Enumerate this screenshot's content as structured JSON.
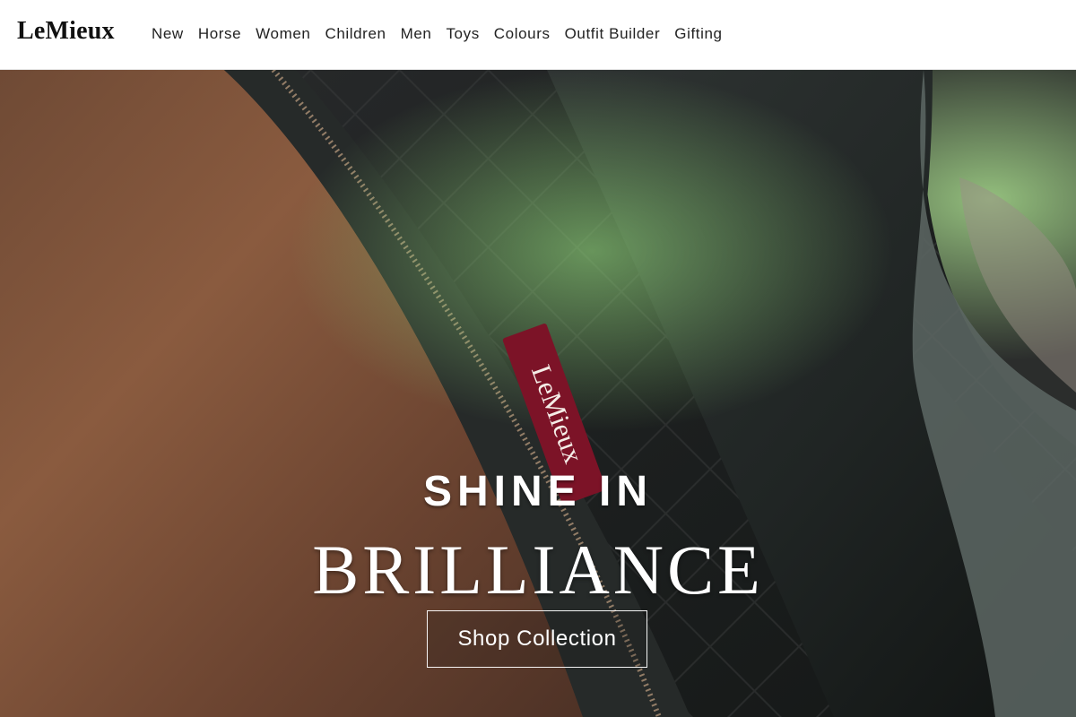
{
  "header": {
    "brand": "LeMieux",
    "nav_items": [
      {
        "label": "New"
      },
      {
        "label": "Horse"
      },
      {
        "label": "Women"
      },
      {
        "label": "Children"
      },
      {
        "label": "Men"
      },
      {
        "label": "Toys"
      },
      {
        "label": "Colours"
      },
      {
        "label": "Outfit Builder"
      },
      {
        "label": "Gifting"
      }
    ]
  },
  "hero": {
    "brand_label": "LeMieux",
    "eyebrow": "SHINE IN",
    "headline": "BRILLIANCE",
    "cta_label": "Shop Collection"
  },
  "colors": {
    "header_bg": "#ffffff",
    "text_dark": "#111111",
    "white": "#ffffff",
    "label_red": "#7c1327"
  }
}
